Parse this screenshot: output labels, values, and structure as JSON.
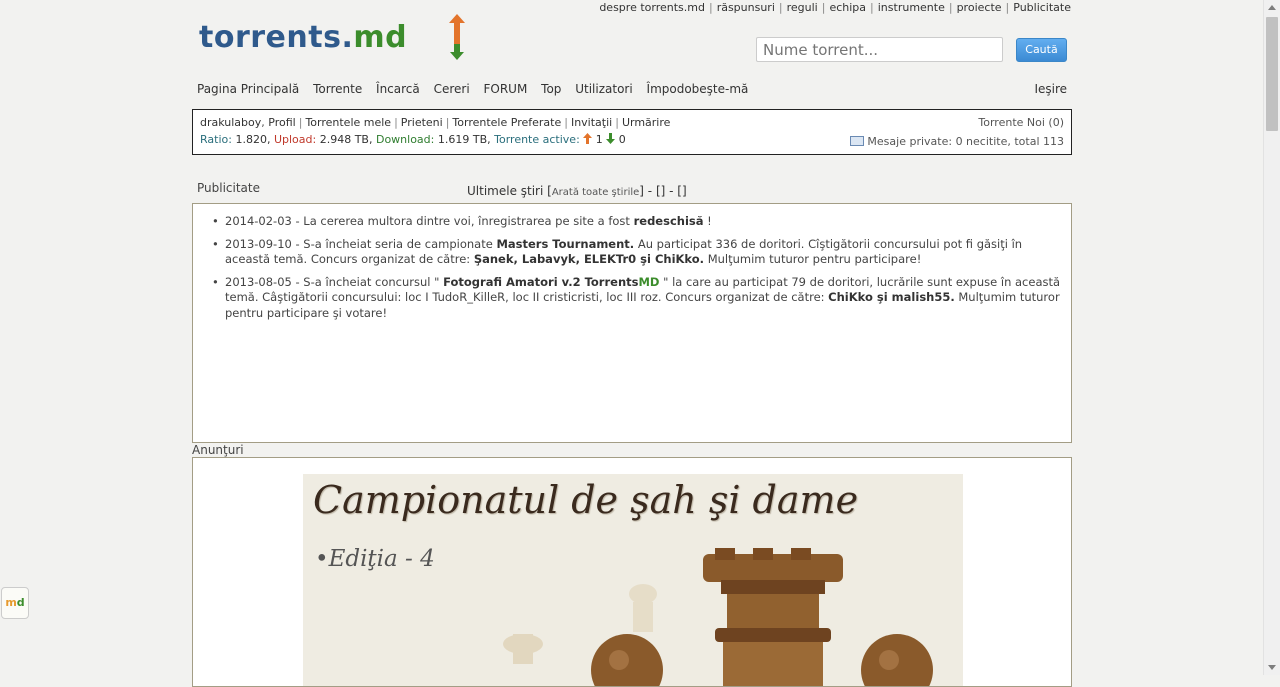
{
  "top_links": [
    "despre torrents.md",
    "răspunsuri",
    "reguli",
    "echipa",
    "instrumente",
    "proiecte",
    "Publicitate"
  ],
  "logo": {
    "text_main": "torrents.",
    "text_md": "md",
    "colors": {
      "main": "#2f5a8c",
      "md": "#3c8d2c",
      "arrow_up": "#e3742b"
    }
  },
  "search": {
    "placeholder": "Nume torrent...",
    "button": "Caută"
  },
  "nav": {
    "items": [
      "Pagina Principală",
      "Torrente",
      "Încarcă",
      "Cereri",
      "FORUM",
      "Top",
      "Utilizatori",
      "Împodobeşte-mă"
    ],
    "logout": "Ieşire"
  },
  "user": {
    "username": "drakulaboy",
    "links": [
      "Profil",
      "Torrentele mele",
      "Prieteni",
      "Torrentele Preferate",
      "Invitaţii",
      "Urmărire"
    ],
    "ratio_label": "Ratio:",
    "ratio": "1.820",
    "upload_label": "Upload:",
    "upload": "2.948 TB",
    "download_label": "Download:",
    "download": "1.619 TB",
    "active_label": "Torrente active:",
    "active_up": "1",
    "active_down": "0",
    "new_torrents": "Torrente Noi (0)",
    "messages": "Mesaje private: 0 necitite, total 113"
  },
  "publicitate_title": "Publicitate",
  "news": {
    "title": "Ultimele ştiri",
    "show_all": "Arată toate ştirile",
    "extra": "- [] - []",
    "items": [
      {
        "date": "2014-02-03",
        "text_a": " - La cererea multora dintre voi, înregistrarea pe site a fost ",
        "bold_a": "redeschisă",
        "text_b": " !"
      },
      {
        "date": "2013-09-10",
        "text_a": " - S-a încheiat seria de campionate ",
        "bold_a": "Masters Tournament.",
        "text_b": " Au participat 336 de doritori. Cîştigătorii concursului pot fi găsiţi în această temă. Concurs organizat de către: ",
        "bold_b": "Şanek, Labavyk, ELEKTr0 şi ChiKko.",
        "text_c": " Mulţumim tuturor pentru participare!"
      },
      {
        "date": "2013-08-05",
        "text_a": " - S-a încheiat concursul \" ",
        "bold_a": "Fotografi Amatori v.2 Torrents",
        "green": "MD",
        "text_b": " \" la care au participat 79 de doritori, lucrările sunt expuse în această temă. Câştigătorii concursului: loc I TudoR_KilleR, loc II cristicristi, loc III roz. Concurs organizat de către: ",
        "bold_b": "ChiKko şi malish55.",
        "text_c": " Mulţumim tuturor pentru participare şi votare!"
      }
    ]
  },
  "anunturi_title": "Anunţuri",
  "banner": {
    "title": "Campionatul de şah şi dame",
    "edition": "•Ediţia - 4"
  },
  "side_badge": {
    "m": "m",
    "d": "d"
  }
}
